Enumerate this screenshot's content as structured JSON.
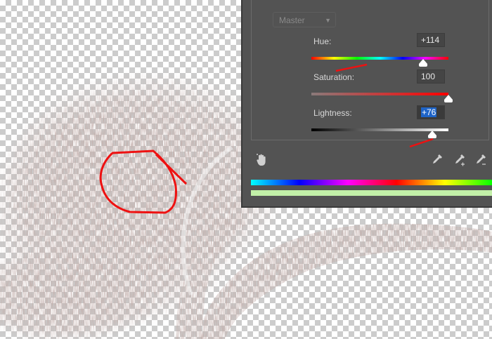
{
  "panel": {
    "channel": "Master",
    "hue": {
      "label": "Hue:",
      "value": "+114",
      "level": 0.8167
    },
    "saturation": {
      "label": "Saturation:",
      "value": "100",
      "level": 1.0
    },
    "lightness": {
      "label": "Lightness:",
      "value": "+76",
      "level": 0.88
    }
  },
  "tools": [
    "hand-target-icon",
    "eyedropper-icon",
    "eyedropper-add-icon",
    "eyedropper-subtract-icon"
  ],
  "colors": {
    "panel_bg": "#535353",
    "annotation_red": "#ee1111",
    "art_brown": "#8a6c65",
    "selected_value_bg": "#1e64c8"
  }
}
